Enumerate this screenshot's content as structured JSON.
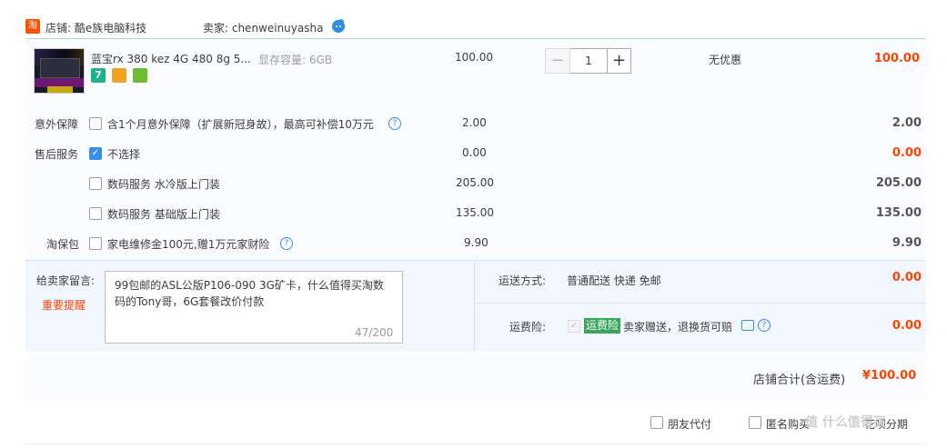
{
  "header": {
    "shop_icon_text": "淘",
    "shop_label": "店铺: 酷e族电脑科技",
    "seller_label": "卖家: chenweinuyasha"
  },
  "item": {
    "title": "蓝宝rx 380 kez 4G 480 8g 5...",
    "spec": "显存容量: 6GB",
    "price": "100.00",
    "quantity": "1",
    "minus": "−",
    "plus": "+",
    "promo": "无优惠",
    "subtotal": "100.00",
    "service_icon_7": "7"
  },
  "options": {
    "accident": {
      "label": "意外保障",
      "text": "含1个月意外保障（扩展新冠身故），最高可补偿10万元",
      "price": "2.00",
      "total": "2.00"
    },
    "after_sale": {
      "label": "售后服务",
      "items": [
        {
          "text": "不选择",
          "price": "0.00",
          "total": "0.00",
          "checked": true
        },
        {
          "text": "数码服务 水冷版上门装",
          "price": "205.00",
          "total": "205.00",
          "checked": false
        },
        {
          "text": "数码服务 基础版上门装",
          "price": "135.00",
          "total": "135.00",
          "checked": false
        }
      ]
    },
    "taobao": {
      "label": "淘保包",
      "text": "家电维修金100元,赠1万元家财险",
      "price": "9.90",
      "total": "9.90"
    },
    "help": "?",
    "check": "✓"
  },
  "message": {
    "label": "给卖家留言:",
    "remind": "重要提醒",
    "text": "99包邮的ASL公版P106-090 3G矿卡，什么值得买淘数码的Tony哥，6G套餐改价付款",
    "count": "47/200"
  },
  "shipping": {
    "label": "运送方式:",
    "method": "普通配送 快递 免邮",
    "price": "0.00"
  },
  "insurance": {
    "label": "运费险:",
    "badge": "运费险",
    "desc": "卖家赠送，退换货可赔",
    "price": "0.00"
  },
  "total": {
    "label": "店铺合计(含运费)",
    "value": "¥100.00"
  },
  "bottom": {
    "friend_pay": "朋友代付",
    "anonymous": "匿名购买",
    "huabei": "花呗分期"
  },
  "watermark": "值 什么值得买",
  "colors": {
    "accent": "#ff4400",
    "blue": "#3a8ee6",
    "panel": "#fbfcff"
  }
}
